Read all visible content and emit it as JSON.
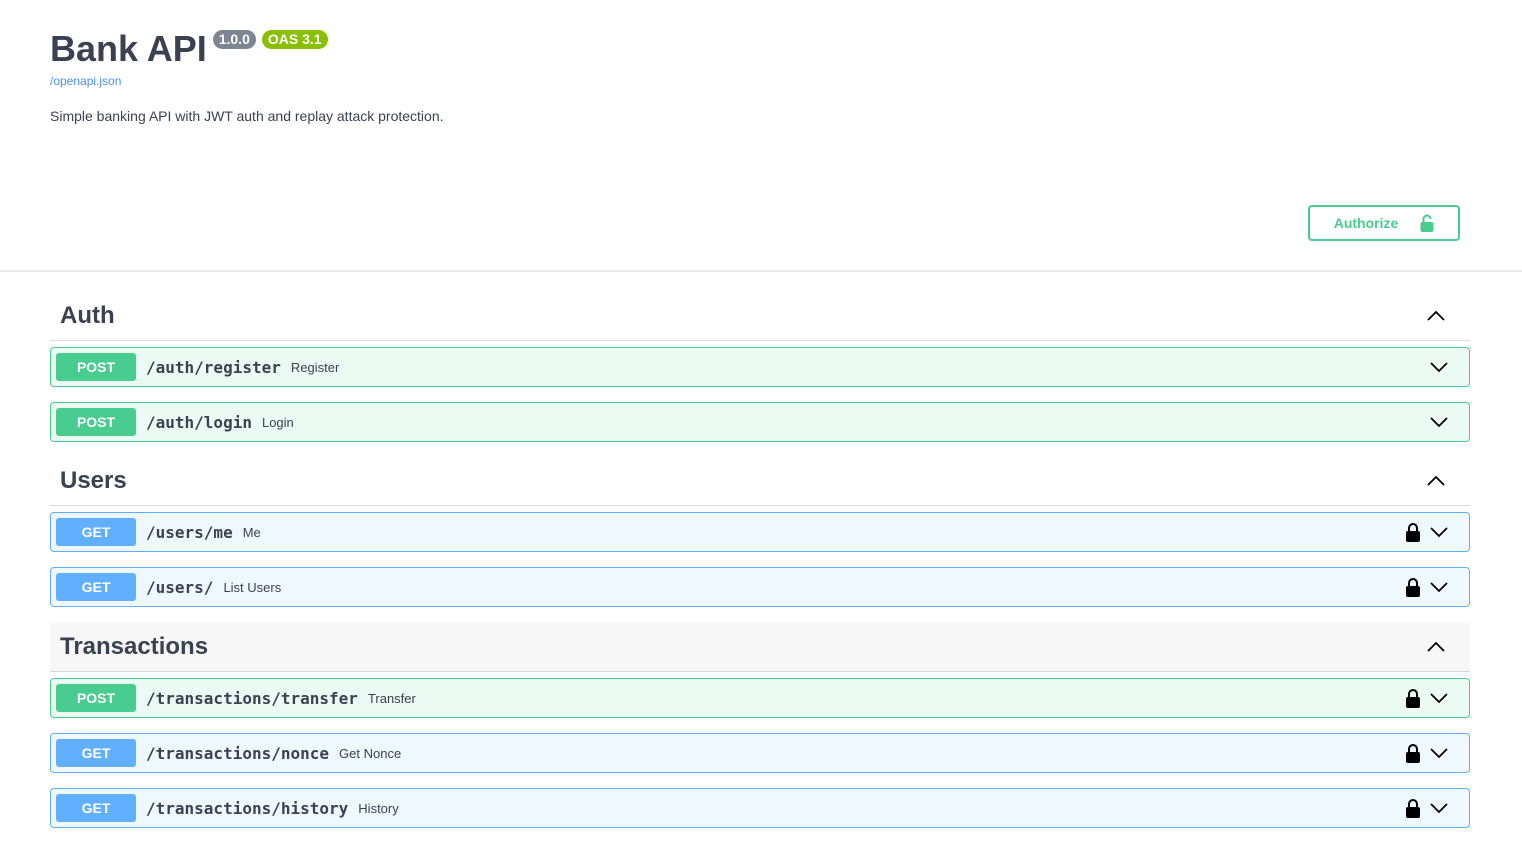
{
  "info": {
    "title": "Bank API",
    "version": "1.0.0",
    "oas_version": "OAS 3.1",
    "spec_url": "/openapi.json",
    "description": "Simple banking API with JWT auth and replay attack protection."
  },
  "authorize": {
    "label": "Authorize",
    "icon": "lock-open-icon",
    "color": "#49cc90"
  },
  "colors": {
    "post": "#49cc90",
    "get": "#61afe",
    "text": "#3b4151",
    "link": "#4990e2"
  },
  "tags": [
    {
      "name": "Auth",
      "expanded": true,
      "operations": [
        {
          "method": "POST",
          "path": "/auth/register",
          "summary": "Register",
          "locked": false
        },
        {
          "method": "POST",
          "path": "/auth/login",
          "summary": "Login",
          "locked": false
        }
      ]
    },
    {
      "name": "Users",
      "expanded": true,
      "operations": [
        {
          "method": "GET",
          "path": "/users/me",
          "summary": "Me",
          "locked": true
        },
        {
          "method": "GET",
          "path": "/users/",
          "summary": "List Users",
          "locked": true
        }
      ]
    },
    {
      "name": "Transactions",
      "expanded": true,
      "operations": [
        {
          "method": "POST",
          "path": "/transactions/transfer",
          "summary": "Transfer",
          "locked": true
        },
        {
          "method": "GET",
          "path": "/transactions/nonce",
          "summary": "Get Nonce",
          "locked": true
        },
        {
          "method": "GET",
          "path": "/transactions/history",
          "summary": "History",
          "locked": true
        }
      ]
    }
  ]
}
